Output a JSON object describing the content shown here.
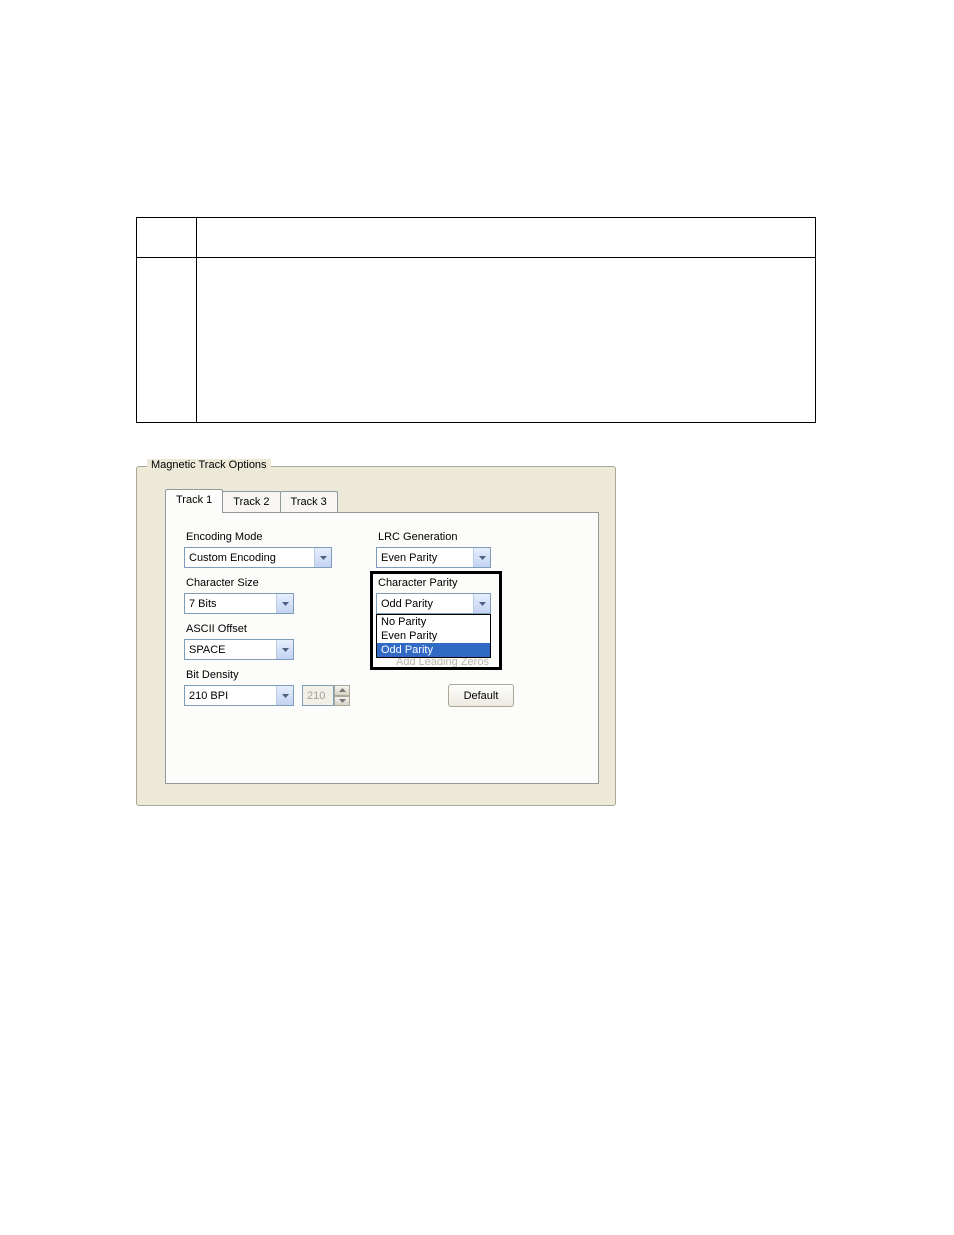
{
  "groupbox": {
    "title": "Magnetic Track Options"
  },
  "tabs": [
    "Track 1",
    "Track 2",
    "Track 3"
  ],
  "labels": {
    "encodingMode": "Encoding Mode",
    "characterSize": "Character Size",
    "asciiOffset": "ASCII Offset",
    "bitDensity": "Bit Density",
    "lrcGeneration": "LRC Generation",
    "characterParity": "Character Parity"
  },
  "fields": {
    "encodingMode": "Custom Encoding",
    "characterSize": "7 Bits",
    "asciiOffset": "SPACE",
    "bitDensity": "210 BPI",
    "bitDensityCustom": "210",
    "lrcGeneration": "Even Parity",
    "characterParity": "Odd Parity"
  },
  "ghost": {
    "addLeadingZeros": "Add Leading Zeros"
  },
  "parityOptions": [
    "No Parity",
    "Even Parity",
    "Odd Parity"
  ],
  "paritySelected": "Odd Parity",
  "defaultBtn": "Default"
}
